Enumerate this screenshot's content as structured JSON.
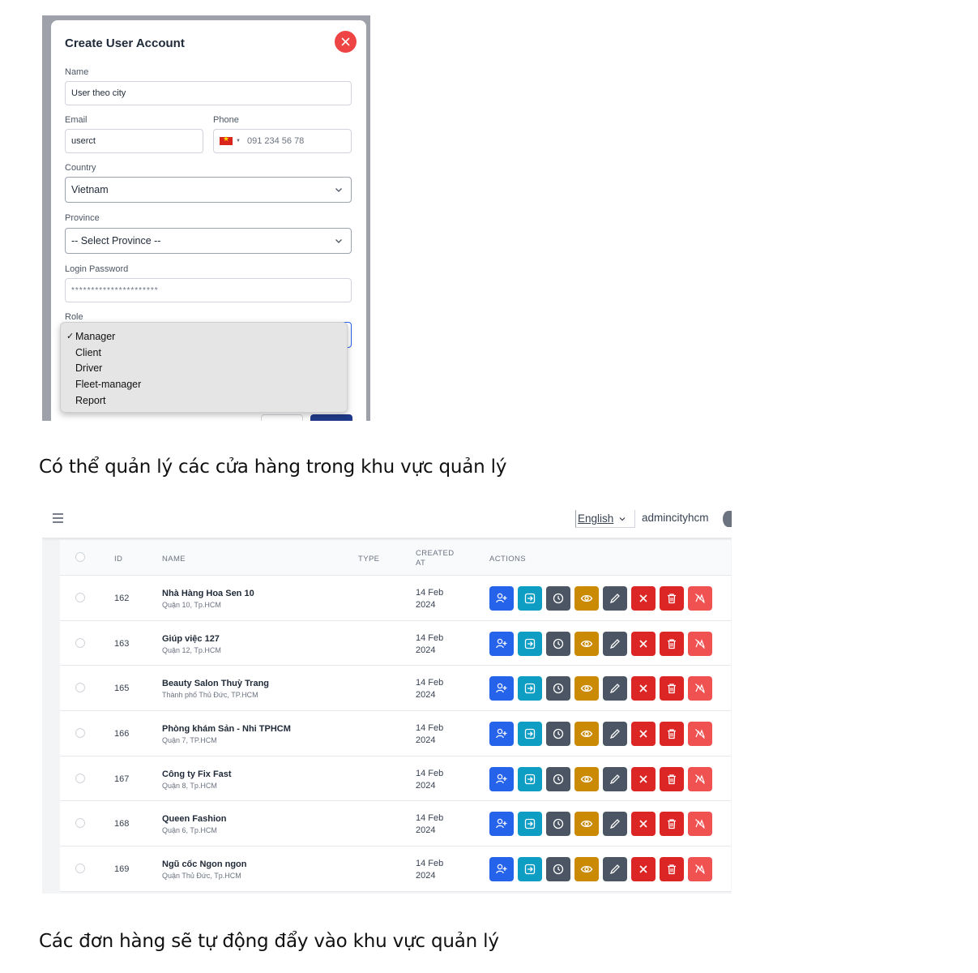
{
  "modal": {
    "title": "Create User Account",
    "name_label": "Name",
    "name_value": "User theo city",
    "email_label": "Email",
    "email_value": "userct",
    "phone_label": "Phone",
    "phone_placeholder": "091 234 56 78",
    "country_label": "Country",
    "country_value": "Vietnam",
    "province_label": "Province",
    "province_value": "-- Select Province --",
    "password_label": "Login Password",
    "password_value": "**********************",
    "role_label": "Role",
    "role_selected": "Manager",
    "role_options": [
      "Manager",
      "Client",
      "Driver",
      "Fleet-manager",
      "Report"
    ]
  },
  "caption1": "Có thể quản lý các cửa hàng trong khu vực quản lý",
  "caption2": "Các đơn hàng sẽ tự động đẩy vào khu vực quản lý",
  "topbar": {
    "language": "English",
    "username": "admincityhcm"
  },
  "table": {
    "headers": {
      "id": "ID",
      "name": "NAME",
      "type": "TYPE",
      "created_line1": "CREATED",
      "created_line2": "AT",
      "actions": "ACTIONS"
    },
    "rows": [
      {
        "id": "162",
        "name": "Nhà Hàng Hoa Sen 10",
        "address": "Quận 10, Tp.HCM",
        "date1": "14 Feb",
        "date2": "2024"
      },
      {
        "id": "163",
        "name": "Giúp việc 127",
        "address": "Quận 12, Tp.HCM",
        "date1": "14 Feb",
        "date2": "2024"
      },
      {
        "id": "165",
        "name": "Beauty Salon Thuỳ Trang",
        "address": "Thành phố Thủ Đức, TP.HCM",
        "date1": "14 Feb",
        "date2": "2024"
      },
      {
        "id": "166",
        "name": "Phòng khám Sản - Nhi TPHCM",
        "address": "Quận 7, TP.HCM",
        "date1": "14 Feb",
        "date2": "2024"
      },
      {
        "id": "167",
        "name": "Công ty Fix Fast",
        "address": "Quận 8, Tp.HCM",
        "date1": "14 Feb",
        "date2": "2024"
      },
      {
        "id": "168",
        "name": "Queen Fashion",
        "address": "Quận 6, Tp.HCM",
        "date1": "14 Feb",
        "date2": "2024"
      },
      {
        "id": "169",
        "name": "Ngũ cốc Ngon ngon",
        "address": "Quận Thủ Đức, Tp.HCM",
        "date1": "14 Feb",
        "date2": "2024"
      }
    ],
    "action_buttons": [
      {
        "icon": "add-user-icon",
        "color": "#2563eb"
      },
      {
        "icon": "login-icon",
        "color": "#0e9ec4"
      },
      {
        "icon": "clock-icon",
        "color": "#4b5563"
      },
      {
        "icon": "eye-icon",
        "color": "#ca8a04"
      },
      {
        "icon": "pencil-icon",
        "color": "#4b5563"
      },
      {
        "icon": "close-icon",
        "color": "#dc2626"
      },
      {
        "icon": "trash-icon",
        "color": "#dc2626"
      },
      {
        "icon": "disable-icon",
        "color": "#f05252"
      }
    ]
  }
}
